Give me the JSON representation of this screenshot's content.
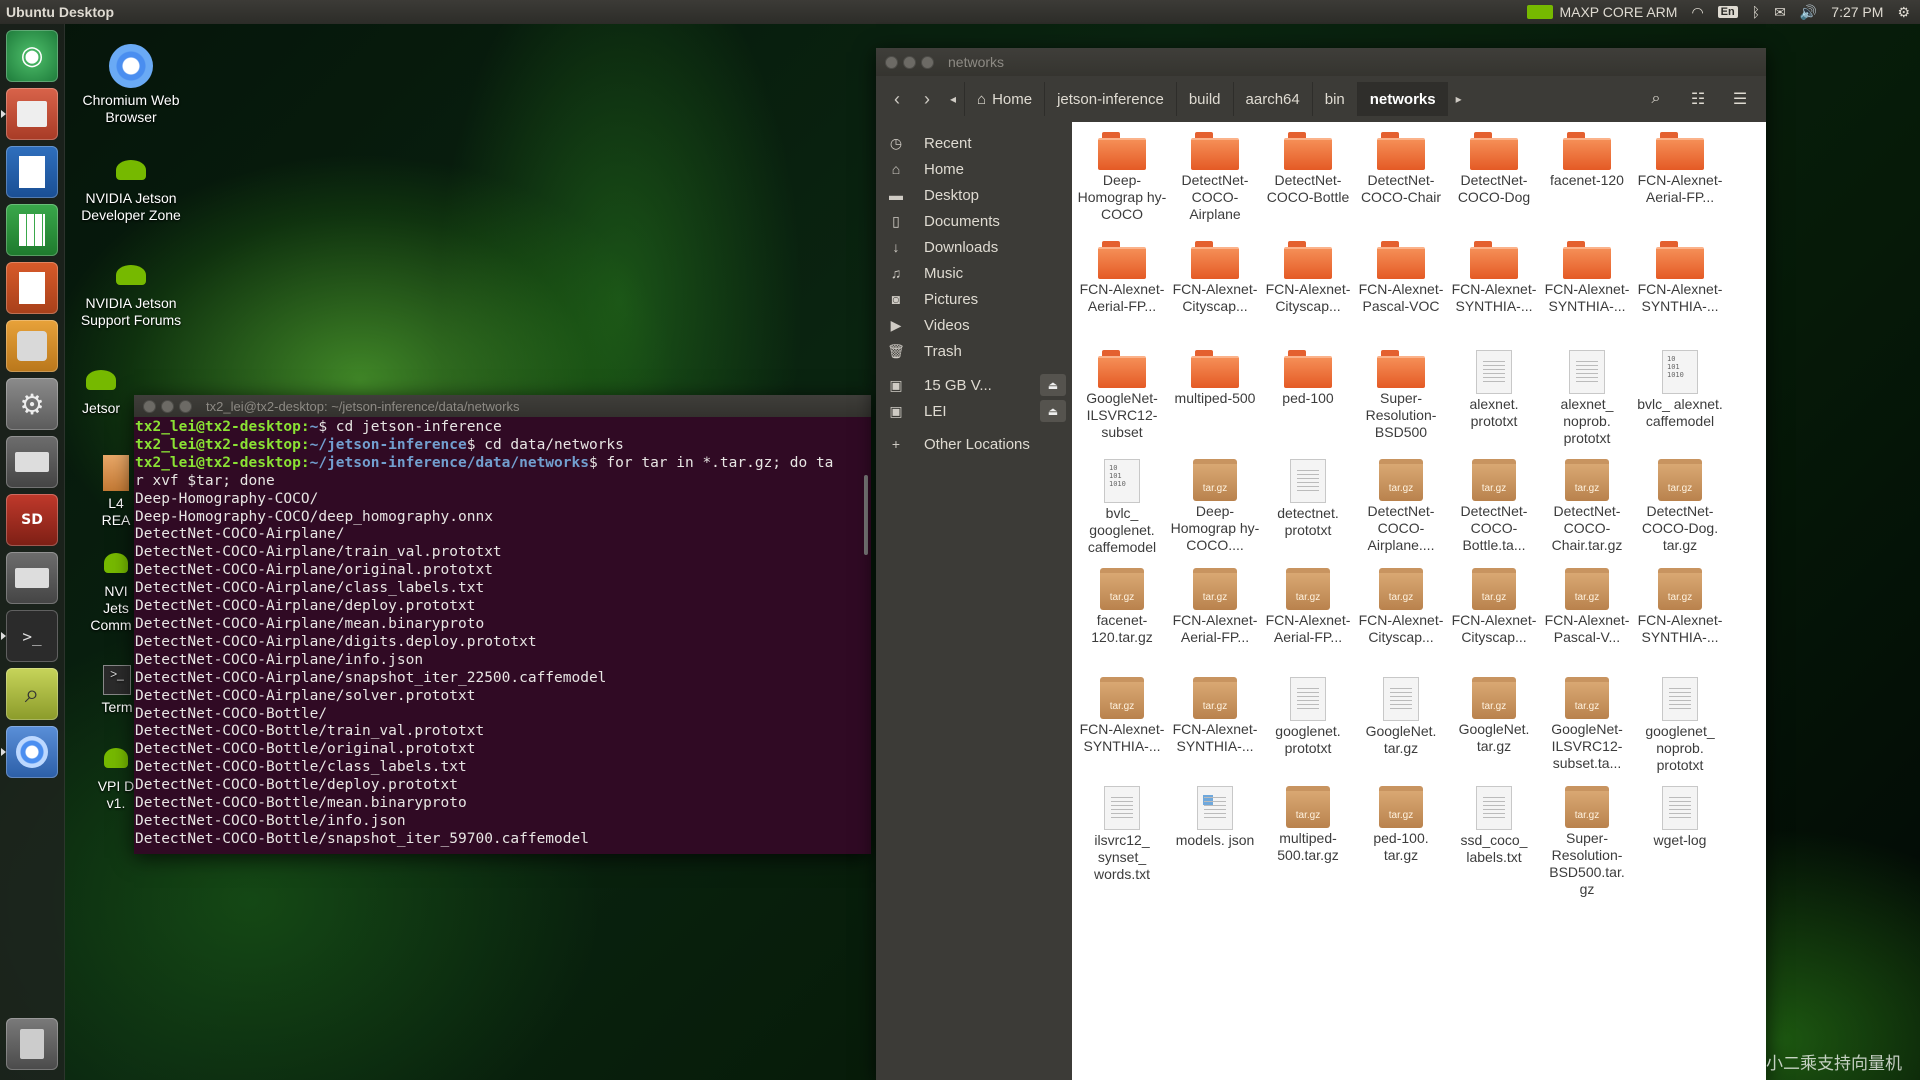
{
  "top_panel": {
    "title": "Ubuntu Desktop",
    "power_mode": "MAXP CORE ARM",
    "keyboard": "En",
    "time": "7:27 PM"
  },
  "launcher": {
    "items": [
      {
        "name": "ubuntu-dash-icon"
      },
      {
        "name": "file-manager-icon"
      },
      {
        "name": "libreoffice-writer-icon"
      },
      {
        "name": "libreoffice-calc-icon"
      },
      {
        "name": "libreoffice-impress-icon"
      },
      {
        "name": "software-center-icon"
      },
      {
        "name": "system-settings-icon"
      },
      {
        "name": "disk-drive-icon"
      },
      {
        "name": "sd-card-icon"
      },
      {
        "name": "usb-drive-icon"
      },
      {
        "name": "terminal-icon"
      },
      {
        "name": "image-viewer-icon"
      },
      {
        "name": "chromium-icon"
      },
      {
        "name": "trash-icon"
      }
    ]
  },
  "desktop": {
    "icons": [
      {
        "label": "Chromium Web Browser",
        "kind": "chromium"
      },
      {
        "label": "NVIDIA Jetson Developer Zone",
        "kind": "nvidia"
      },
      {
        "label": "NVIDIA Jetson Support Forums",
        "kind": "nvidia"
      },
      {
        "label": "Jetson",
        "kind": "nvidia"
      },
      {
        "label": "L4 README",
        "kind": "doc"
      },
      {
        "label": "NVI Jetson Comm",
        "kind": "nvidia"
      },
      {
        "label": "Term",
        "kind": "terminal"
      },
      {
        "label": "VPI D v1.",
        "kind": "nvidia"
      }
    ],
    "partial_labels": {
      "jetson": "Jetsor",
      "l4": "L4",
      "readme": "REA",
      "nvi": "NVI",
      "jets": "Jets",
      "comm": "Comm",
      "term": "Term",
      "vpi": "VPI D",
      "v1": "v1."
    }
  },
  "terminal": {
    "title": "tx2_lei@tx2-desktop: ~/jetson-inference/data/networks",
    "prompt_user": "tx2_lei@tx2-desktop",
    "lines": [
      {
        "type": "prompt",
        "path": "~",
        "cmd": "$ cd jetson-inference"
      },
      {
        "type": "prompt",
        "path": "~/jetson-inference",
        "cmd": "$ cd data/networks"
      },
      {
        "type": "prompt",
        "path": "~/jetson-inference/data/networks",
        "cmd": "$ for tar in *.tar.gz; do ta"
      },
      {
        "type": "out",
        "text": "r xvf $tar; done"
      },
      {
        "type": "out",
        "text": "Deep-Homography-COCO/"
      },
      {
        "type": "out",
        "text": "Deep-Homography-COCO/deep_homography.onnx"
      },
      {
        "type": "out",
        "text": "DetectNet-COCO-Airplane/"
      },
      {
        "type": "out",
        "text": "DetectNet-COCO-Airplane/train_val.prototxt"
      },
      {
        "type": "out",
        "text": "DetectNet-COCO-Airplane/original.prototxt"
      },
      {
        "type": "out",
        "text": "DetectNet-COCO-Airplane/class_labels.txt"
      },
      {
        "type": "out",
        "text": "DetectNet-COCO-Airplane/deploy.prototxt"
      },
      {
        "type": "out",
        "text": "DetectNet-COCO-Airplane/mean.binaryproto"
      },
      {
        "type": "out",
        "text": "DetectNet-COCO-Airplane/digits.deploy.prototxt"
      },
      {
        "type": "out",
        "text": "DetectNet-COCO-Airplane/info.json"
      },
      {
        "type": "out",
        "text": "DetectNet-COCO-Airplane/snapshot_iter_22500.caffemodel"
      },
      {
        "type": "out",
        "text": "DetectNet-COCO-Airplane/solver.prototxt"
      },
      {
        "type": "out",
        "text": "DetectNet-COCO-Bottle/"
      },
      {
        "type": "out",
        "text": "DetectNet-COCO-Bottle/train_val.prototxt"
      },
      {
        "type": "out",
        "text": "DetectNet-COCO-Bottle/original.prototxt"
      },
      {
        "type": "out",
        "text": "DetectNet-COCO-Bottle/class_labels.txt"
      },
      {
        "type": "out",
        "text": "DetectNet-COCO-Bottle/deploy.prototxt"
      },
      {
        "type": "out",
        "text": "DetectNet-COCO-Bottle/mean.binaryproto"
      },
      {
        "type": "out",
        "text": "DetectNet-COCO-Bottle/info.json"
      },
      {
        "type": "out",
        "text": "DetectNet-COCO-Bottle/snapshot_iter_59700.caffemodel"
      }
    ]
  },
  "files": {
    "window_title": "networks",
    "breadcrumbs": [
      "Home",
      "jetson-inference",
      "build",
      "aarch64",
      "bin",
      "networks"
    ],
    "active_crumb": "networks",
    "sidebar": [
      {
        "label": "Recent",
        "icon": "clock-icon",
        "glyph": "◷"
      },
      {
        "label": "Home",
        "icon": "home-icon",
        "glyph": "⌂"
      },
      {
        "label": "Desktop",
        "icon": "desktop-icon",
        "glyph": "▬"
      },
      {
        "label": "Documents",
        "icon": "documents-icon",
        "glyph": "▯"
      },
      {
        "label": "Downloads",
        "icon": "downloads-icon",
        "glyph": "↓"
      },
      {
        "label": "Music",
        "icon": "music-icon",
        "glyph": "♫"
      },
      {
        "label": "Pictures",
        "icon": "pictures-icon",
        "glyph": "◙"
      },
      {
        "label": "Videos",
        "icon": "videos-icon",
        "glyph": "▶"
      },
      {
        "label": "Trash",
        "icon": "trash-icon",
        "glyph": "🗑"
      },
      {
        "label": "15 GB V...",
        "icon": "drive-icon",
        "glyph": "▣",
        "eject": true
      },
      {
        "label": "LEI",
        "icon": "drive-icon",
        "glyph": "▣",
        "eject": true
      },
      {
        "label": "Other Locations",
        "icon": "plus-icon",
        "glyph": "+"
      }
    ],
    "items": [
      {
        "label": "Deep-Homograp hy-COCO",
        "type": "folder"
      },
      {
        "label": "DetectNet-COCO-Airplane",
        "type": "folder"
      },
      {
        "label": "DetectNet-COCO-Bottle",
        "type": "folder"
      },
      {
        "label": "DetectNet-COCO-Chair",
        "type": "folder"
      },
      {
        "label": "DetectNet-COCO-Dog",
        "type": "folder"
      },
      {
        "label": "facenet-120",
        "type": "folder"
      },
      {
        "label": "FCN-Alexnet-Aerial-FP...",
        "type": "folder"
      },
      {
        "label": "FCN-Alexnet-Aerial-FP...",
        "type": "folder"
      },
      {
        "label": "FCN-Alexnet-Cityscap...",
        "type": "folder"
      },
      {
        "label": "FCN-Alexnet-Cityscap...",
        "type": "folder"
      },
      {
        "label": "FCN-Alexnet-Pascal-VOC",
        "type": "folder"
      },
      {
        "label": "FCN-Alexnet-SYNTHIA-...",
        "type": "folder"
      },
      {
        "label": "FCN-Alexnet-SYNTHIA-...",
        "type": "folder"
      },
      {
        "label": "FCN-Alexnet-SYNTHIA-...",
        "type": "folder"
      },
      {
        "label": "GoogleNet-ILSVRC12-subset",
        "type": "folder"
      },
      {
        "label": "multiped-500",
        "type": "folder"
      },
      {
        "label": "ped-100",
        "type": "folder"
      },
      {
        "label": "Super-Resolution-BSD500",
        "type": "folder"
      },
      {
        "label": "alexnet. prototxt",
        "type": "doc"
      },
      {
        "label": "alexnet_ noprob. prototxt",
        "type": "doc"
      },
      {
        "label": "bvlc_ alexnet. caffemodel",
        "type": "bin"
      },
      {
        "label": "bvlc_ googlenet. caffemodel",
        "type": "bin"
      },
      {
        "label": "Deep-Homograp hy-COCO....",
        "type": "archive"
      },
      {
        "label": "detectnet. prototxt",
        "type": "doc"
      },
      {
        "label": "DetectNet-COCO-Airplane....",
        "type": "archive"
      },
      {
        "label": "DetectNet-COCO-Bottle.ta...",
        "type": "archive"
      },
      {
        "label": "DetectNet-COCO-Chair.tar.gz",
        "type": "archive"
      },
      {
        "label": "DetectNet-COCO-Dog. tar.gz",
        "type": "archive"
      },
      {
        "label": "facenet-120.tar.gz",
        "type": "archive"
      },
      {
        "label": "FCN-Alexnet-Aerial-FP...",
        "type": "archive"
      },
      {
        "label": "FCN-Alexnet-Aerial-FP...",
        "type": "archive"
      },
      {
        "label": "FCN-Alexnet-Cityscap...",
        "type": "archive"
      },
      {
        "label": "FCN-Alexnet-Cityscap...",
        "type": "archive"
      },
      {
        "label": "FCN-Alexnet-Pascal-V...",
        "type": "archive"
      },
      {
        "label": "FCN-Alexnet-SYNTHIA-...",
        "type": "archive"
      },
      {
        "label": "FCN-Alexnet-SYNTHIA-...",
        "type": "archive"
      },
      {
        "label": "FCN-Alexnet-SYNTHIA-...",
        "type": "archive"
      },
      {
        "label": "googlenet. prototxt",
        "type": "doc"
      },
      {
        "label": "GoogleNet. tar.gz",
        "type": "doc"
      },
      {
        "label": "GoogleNet. tar.gz",
        "type": "archive"
      },
      {
        "label": "GoogleNet-ILSVRC12-subset.ta...",
        "type": "archive"
      },
      {
        "label": "googlenet_ noprob. prototxt",
        "type": "doc"
      },
      {
        "label": "ilsvrc12_ synset_ words.txt",
        "type": "doc"
      },
      {
        "label": "models. json",
        "type": "json"
      },
      {
        "label": "multiped-500.tar.gz",
        "type": "archive"
      },
      {
        "label": "ped-100. tar.gz",
        "type": "archive"
      },
      {
        "label": "ssd_coco_ labels.txt",
        "type": "doc"
      },
      {
        "label": "Super-Resolution-BSD500.tar. gz",
        "type": "archive"
      },
      {
        "label": "wget-log",
        "type": "doc"
      }
    ],
    "archive_tag": "tar.gz"
  },
  "watermark": "CSDN @鲁棒最小二乘支持向量机",
  "colors": {
    "accent_orange": "#e45a25",
    "terminal_bg": "#300a24",
    "prompt_green": "#8ae234",
    "prompt_blue": "#729fcf",
    "nvidia_green": "#76b900"
  }
}
